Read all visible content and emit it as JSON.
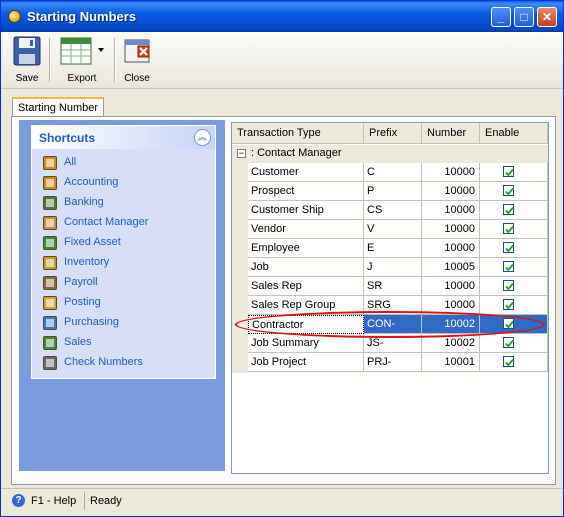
{
  "window": {
    "title": "Starting Numbers"
  },
  "toolbar": {
    "save_label": "Save",
    "export_label": "Export",
    "close_label": "Close"
  },
  "tab": {
    "label": "Starting Number"
  },
  "shortcuts": {
    "title": "Shortcuts",
    "items": [
      {
        "label": "All",
        "icon": "grid-icon"
      },
      {
        "label": "Accounting",
        "icon": "ledger-icon"
      },
      {
        "label": "Banking",
        "icon": "bank-icon"
      },
      {
        "label": "Contact Manager",
        "icon": "contact-icon"
      },
      {
        "label": "Fixed Asset",
        "icon": "asset-icon"
      },
      {
        "label": "Inventory",
        "icon": "box-icon"
      },
      {
        "label": "Payroll",
        "icon": "payroll-icon"
      },
      {
        "label": "Posting",
        "icon": "posting-icon"
      },
      {
        "label": "Purchasing",
        "icon": "purchasing-icon"
      },
      {
        "label": "Sales",
        "icon": "sales-icon"
      },
      {
        "label": "Check Numbers",
        "icon": "check-icon"
      }
    ]
  },
  "grid": {
    "headers": {
      "type": "Transaction Type",
      "prefix": "Prefix",
      "number": "Number",
      "enable": "Enable"
    },
    "group": ": Contact Manager",
    "rows": [
      {
        "type": "Customer",
        "prefix": "C",
        "number": "10000",
        "enable": true
      },
      {
        "type": "Prospect",
        "prefix": "P",
        "number": "10000",
        "enable": true
      },
      {
        "type": "Customer Ship",
        "prefix": "CS",
        "number": "10000",
        "enable": true
      },
      {
        "type": "Vendor",
        "prefix": "V",
        "number": "10000",
        "enable": true
      },
      {
        "type": "Employee",
        "prefix": "E",
        "number": "10000",
        "enable": true
      },
      {
        "type": "Job",
        "prefix": "J",
        "number": "10005",
        "enable": true
      },
      {
        "type": "Sales Rep",
        "prefix": "SR",
        "number": "10000",
        "enable": true
      },
      {
        "type": "Sales Rep Group",
        "prefix": "SRG",
        "number": "10000",
        "enable": true
      },
      {
        "type": "Contractor",
        "prefix": "CON-",
        "number": "10002",
        "enable": true
      },
      {
        "type": "Job Summary",
        "prefix": "JS-",
        "number": "10002",
        "enable": true
      },
      {
        "type": "Job Project",
        "prefix": "PRJ-",
        "number": "10001",
        "enable": true
      }
    ]
  },
  "status": {
    "help": "F1 - Help",
    "state": "Ready"
  },
  "colors": {
    "selection": "#316ac5",
    "highlight_oval": "#e01010",
    "link": "#215dc6"
  }
}
